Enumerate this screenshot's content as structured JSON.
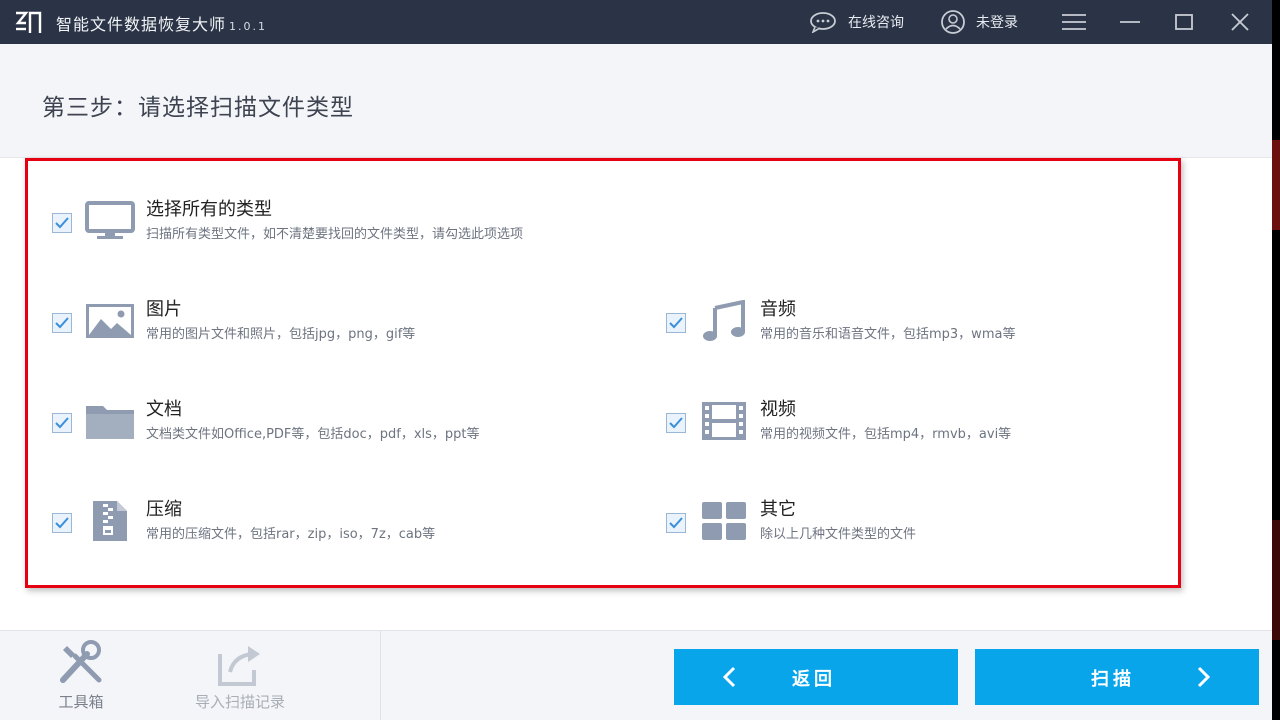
{
  "window": {
    "title": "智能文件数据恢复大师",
    "version": "1.0.1",
    "consult_label": "在线咨询",
    "login_label": "未登录"
  },
  "header": {
    "step_title": "第三步：请选择扫描文件类型"
  },
  "options": {
    "all": {
      "title": "选择所有的类型",
      "desc": "扫描所有类型文件，如不清楚要找回的文件类型，请勾选此项选项",
      "checked": true,
      "icon": "monitor-icon"
    },
    "image": {
      "title": "图片",
      "desc": "常用的图片文件和照片，包括jpg，png，gif等",
      "checked": true,
      "icon": "image-icon"
    },
    "audio": {
      "title": "音频",
      "desc": "常用的音乐和语音文件，包括mp3，wma等",
      "checked": true,
      "icon": "music-note-icon"
    },
    "document": {
      "title": "文档",
      "desc": "文档类文件如Office,PDF等，包括doc，pdf，xls，ppt等",
      "checked": true,
      "icon": "folder-icon"
    },
    "video": {
      "title": "视频",
      "desc": "常用的视频文件，包括mp4，rmvb，avi等",
      "checked": true,
      "icon": "film-icon"
    },
    "archive": {
      "title": "压缩",
      "desc": "常用的压缩文件，包括rar，zip，iso，7z，cab等",
      "checked": true,
      "icon": "zip-icon"
    },
    "other": {
      "title": "其它",
      "desc": "除以上几种文件类型的文件",
      "checked": true,
      "icon": "grid-icon"
    }
  },
  "bottom": {
    "toolbox_label": "工具箱",
    "import_label": "导入扫描记录",
    "back_label": "返回",
    "scan_label": "扫描"
  },
  "colors": {
    "titlebar": "#2b3446",
    "accent_button": "#08a5ea",
    "highlight_border": "#e60012",
    "icon_gray": "#8e9bb0"
  }
}
